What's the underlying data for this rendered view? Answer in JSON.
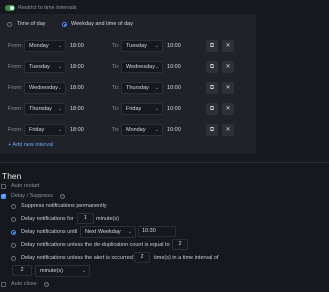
{
  "restrict": {
    "label": "Restrict to time intervals",
    "enabled": true
  },
  "mode": {
    "options": [
      {
        "label": "Time of day",
        "selected": false
      },
      {
        "label": "Weekday and time of day",
        "selected": true
      }
    ]
  },
  "intervals": [
    {
      "from_label": "From:",
      "from_day": "Monday",
      "from_time": "18:00",
      "to_label": "To:",
      "to_day": "Tuesday",
      "to_time": "10:00"
    },
    {
      "from_label": "From:",
      "from_day": "Tuesday",
      "from_time": "18:00",
      "to_label": "To:",
      "to_day": "Wednesday",
      "to_time": "10:00"
    },
    {
      "from_label": "From:",
      "from_day": "Wednesday",
      "from_time": "18:00",
      "to_label": "To:",
      "to_day": "Thursday",
      "to_time": "10:00"
    },
    {
      "from_label": "From:",
      "from_day": "Thursday",
      "from_time": "18:00",
      "to_label": "To:",
      "to_day": "Friday",
      "to_time": "10:00"
    },
    {
      "from_label": "From:",
      "from_day": "Friday",
      "from_time": "18:00",
      "to_label": "To:",
      "to_day": "Monday",
      "to_time": "10:00"
    }
  ],
  "icons": {
    "caret": "⌄",
    "copy": "⧉",
    "remove": "✕",
    "info": "?"
  },
  "add_interval": "+ Add new interval",
  "then": {
    "title": "Then",
    "auto_restart": {
      "label": "Auto restart",
      "checked": false
    },
    "delay_suppress": {
      "label": "Delay / Suppress",
      "checked": true
    },
    "suppress_permanently": "Suppress notifications permanently",
    "delay_for": {
      "label": "Delay notifications for",
      "value": "1",
      "unit": "minute(s)"
    },
    "delay_until": {
      "label": "Delay notifications until",
      "day": "Next Weekday",
      "time": "10:30"
    },
    "delay_dedup": {
      "label": "Delay notifications unless the de-duplication count is equal to",
      "value": "2"
    },
    "delay_alert": {
      "label": "Delay notifications unless the alert is occurred",
      "value": "2",
      "suffix": "time(s) in a time interval of",
      "interval_value": "2",
      "interval_unit": "minute(s)"
    },
    "auto_close": {
      "label": "Auto close",
      "checked": false
    }
  },
  "colors": {
    "accent": "#4c8ff5",
    "toggle_on": "#3d8a4f",
    "link": "#6aa3f8"
  }
}
